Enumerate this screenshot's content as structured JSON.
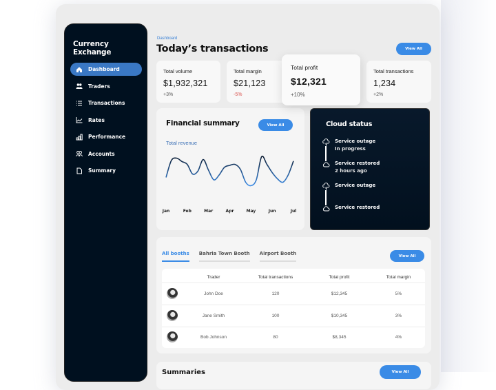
{
  "app": {
    "title": "Currency Exchange"
  },
  "sidebar": {
    "items": [
      {
        "label": "Dashboard",
        "icon": "home-icon",
        "active": true
      },
      {
        "label": "Traders",
        "icon": "users-icon"
      },
      {
        "label": "Transactions",
        "icon": "list-icon"
      },
      {
        "label": "Rates",
        "icon": "line-chart-icon"
      },
      {
        "label": "Performance",
        "icon": "bar-chart-icon"
      },
      {
        "label": "Accounts",
        "icon": "accounts-icon"
      },
      {
        "label": "Summary",
        "icon": "document-icon"
      }
    ]
  },
  "header": {
    "breadcrumb": "Dashboard",
    "title": "Today’s transactions",
    "view_all": "View All"
  },
  "stats": [
    {
      "label": "Total volume",
      "value": "$1,932,321",
      "change": "+3%"
    },
    {
      "label": "Total margin",
      "value": "$21,123",
      "change": "-5%"
    },
    {
      "label": "Total profit",
      "value": "$12,321",
      "change": "+10%"
    },
    {
      "label": "Total transactions",
      "value": "1,234",
      "change": "+2%"
    }
  ],
  "financial_summary": {
    "title": "Financial summary",
    "view_all": "View All",
    "subtitle": "Total revenue",
    "chart_data": {
      "type": "line",
      "title": "Total revenue",
      "categories": [
        "Jan",
        "Feb",
        "Mar",
        "Apr",
        "May",
        "Jun",
        "Jul"
      ],
      "x": [
        0,
        0.25,
        0.5,
        0.75,
        1.0,
        1.25,
        1.5,
        1.75,
        2.0,
        2.25,
        2.5,
        2.75,
        3.0,
        3.25,
        3.5,
        3.75,
        4.0,
        4.25,
        4.5,
        4.75,
        5.0,
        5.25,
        5.5,
        5.75,
        6.0
      ],
      "values": [
        45,
        80,
        85,
        78,
        72,
        52,
        58,
        82,
        60,
        40,
        50,
        66,
        70,
        72,
        62,
        35,
        28,
        40,
        88,
        72,
        55,
        42,
        35,
        50,
        79
      ],
      "xlabel": "",
      "ylabel": "",
      "ylim": [
        0,
        100
      ],
      "grid": false,
      "colors": {
        "line_top": "#0a1a30",
        "line_bottom": "#3a8be6"
      }
    }
  },
  "cloud_status": {
    "title": "Cloud status",
    "events": [
      {
        "title": "Service outage",
        "subtitle": "In progress",
        "icon": "cloud-lightning-icon"
      },
      {
        "title": "Service restored",
        "subtitle": "2 hours ago",
        "icon": "cloud-icon"
      },
      {
        "title": "Service outage",
        "subtitle": "",
        "icon": "cloud-lightning-icon"
      },
      {
        "title": "Service restored",
        "subtitle": "",
        "icon": "cloud-icon"
      }
    ]
  },
  "booths": {
    "tabs": [
      {
        "label": "All booths",
        "active": true
      },
      {
        "label": "Bahria Town Booth"
      },
      {
        "label": "Airport Booth"
      }
    ],
    "view_all": "View All",
    "columns": [
      "Trader",
      "Total transactions",
      "Total profit",
      "Total margin"
    ],
    "rows": [
      {
        "trader": "John Doe",
        "transactions": "120",
        "profit": "$12,345",
        "margin": "5%"
      },
      {
        "trader": "Jane Smith",
        "transactions": "100",
        "profit": "$10,345",
        "margin": "3%"
      },
      {
        "trader": "Bob Johnson",
        "transactions": "80",
        "profit": "$8,345",
        "margin": "4%"
      }
    ]
  },
  "bottom_section": {
    "title": "Summaries",
    "view_all": "View All"
  },
  "colors": {
    "accent": "#3a8be6",
    "sidebar_bg": "#00101f",
    "active_nav": "#3a78c4",
    "negative": "#d9534f"
  }
}
